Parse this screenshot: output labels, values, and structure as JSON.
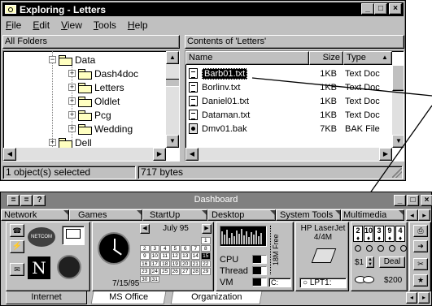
{
  "explorer": {
    "title": "Exploring - Letters",
    "menu": [
      {
        "label": "File",
        "key": "F",
        "rest": "ile"
      },
      {
        "label": "Edit",
        "key": "E",
        "rest": "dit"
      },
      {
        "label": "View",
        "key": "V",
        "rest": "iew"
      },
      {
        "label": "Tools",
        "key": "T",
        "rest": "ools"
      },
      {
        "label": "Help",
        "key": "H",
        "rest": "elp"
      }
    ],
    "left_header": "All Folders",
    "right_header": "Contents of 'Letters'",
    "tree": [
      "Data",
      "Dash4doc",
      "Letters",
      "Oldlet",
      "Pcg",
      "Wedding",
      "Dell"
    ],
    "columns": {
      "name": "Name",
      "size": "Size",
      "type": "Type"
    },
    "files": [
      {
        "name": "Barb01.txt",
        "size": "1KB",
        "type": "Text Doc"
      },
      {
        "name": "Borlinv.txt",
        "size": "1KB",
        "type": "Text Doc"
      },
      {
        "name": "Daniel01.txt",
        "size": "1KB",
        "type": "Text Doc"
      },
      {
        "name": "Dataman.txt",
        "size": "1KB",
        "type": "Text Doc"
      },
      {
        "name": "Dmv01.bak",
        "size": "7KB",
        "type": "BAK File"
      }
    ],
    "status": {
      "selected": "1 object(s) selected",
      "bytes": "717 bytes"
    }
  },
  "dashboard": {
    "title": "Dashboard",
    "tabs": [
      "Network",
      "Games",
      "StartUp",
      "Desktop",
      "System Tools",
      "Multimedia"
    ],
    "bottom_tabs": [
      "Internet",
      "MS Office",
      "Organization"
    ],
    "calendar": {
      "month": "July 95",
      "rows": [
        [
          "",
          "",
          "",
          "",
          "",
          "",
          "1"
        ],
        [
          "2",
          "3",
          "4",
          "5",
          "6",
          "7",
          "8"
        ],
        [
          "9",
          "10",
          "11",
          "12",
          "13",
          "14",
          "15"
        ],
        [
          "16",
          "17",
          "18",
          "19",
          "20",
          "21",
          "22"
        ],
        [
          "23",
          "24",
          "25",
          "26",
          "27",
          "28",
          "29"
        ],
        [
          "30",
          "31",
          "",
          "",
          "",
          "",
          ""
        ]
      ],
      "highlighted": "15"
    },
    "date": "7/15/95",
    "meters": {
      "cpu": "CPU",
      "thread": "Thread",
      "vm": "VM"
    },
    "free": "18M Free",
    "drive": "C:",
    "printer": {
      "name": "HP LaserJet",
      "model": "4/4M",
      "port": "LPT1:"
    },
    "cards": [
      "2",
      "10",
      "3",
      "9",
      "4"
    ],
    "bet": "$1",
    "deal": "Deal",
    "money": "$200",
    "netcom": "NETCOM"
  },
  "colors": {
    "titlebar": "#000000",
    "dash_titlebar": "#808080",
    "face": "#c0c0c0",
    "highlight": "#ff0000"
  }
}
